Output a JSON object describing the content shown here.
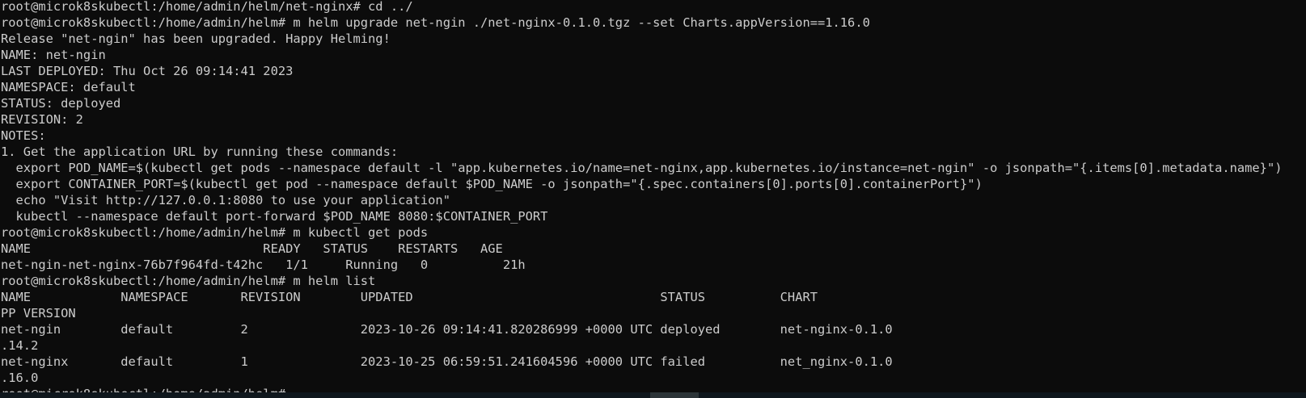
{
  "terminal": {
    "lines": [
      "root@microk8skubectl:/home/admin/helm/net-nginx# cd ../",
      "root@microk8skubectl:/home/admin/helm# m helm upgrade net-ngin ./net-nginx-0.1.0.tgz --set Charts.appVersion==1.16.0",
      "Release \"net-ngin\" has been upgraded. Happy Helming!",
      "NAME: net-ngin",
      "LAST DEPLOYED: Thu Oct 26 09:14:41 2023",
      "NAMESPACE: default",
      "STATUS: deployed",
      "REVISION: 2",
      "NOTES:",
      "1. Get the application URL by running these commands:",
      "  export POD_NAME=$(kubectl get pods --namespace default -l \"app.kubernetes.io/name=net-nginx,app.kubernetes.io/instance=net-ngin\" -o jsonpath=\"{.items[0].metadata.name}\")",
      "  export CONTAINER_PORT=$(kubectl get pod --namespace default $POD_NAME -o jsonpath=\"{.spec.containers[0].ports[0].containerPort}\")",
      "  echo \"Visit http://127.0.0.1:8080 to use your application\"",
      "  kubectl --namespace default port-forward $POD_NAME 8080:$CONTAINER_PORT",
      "root@microk8skubectl:/home/admin/helm# m kubectl get pods",
      "NAME                               READY   STATUS    RESTARTS   AGE",
      "net-ngin-net-nginx-76b7f964fd-t42hc   1/1     Running   0          21h",
      "root@microk8skubectl:/home/admin/helm# m helm list",
      "NAME            NAMESPACE       REVISION        UPDATED                                 STATUS          CHART",
      "PP VERSION",
      "net-ngin        default         2               2023-10-26 09:14:41.820286999 +0000 UTC deployed        net-nginx-0.1.0",
      ".14.2",
      "net-nginx       default         1               2023-10-25 06:59:51.241604596 +0000 UTC failed          net_nginx-0.1.0",
      ".16.0"
    ],
    "prompt": "root@microk8skubectl:/home/admin/helm# "
  }
}
